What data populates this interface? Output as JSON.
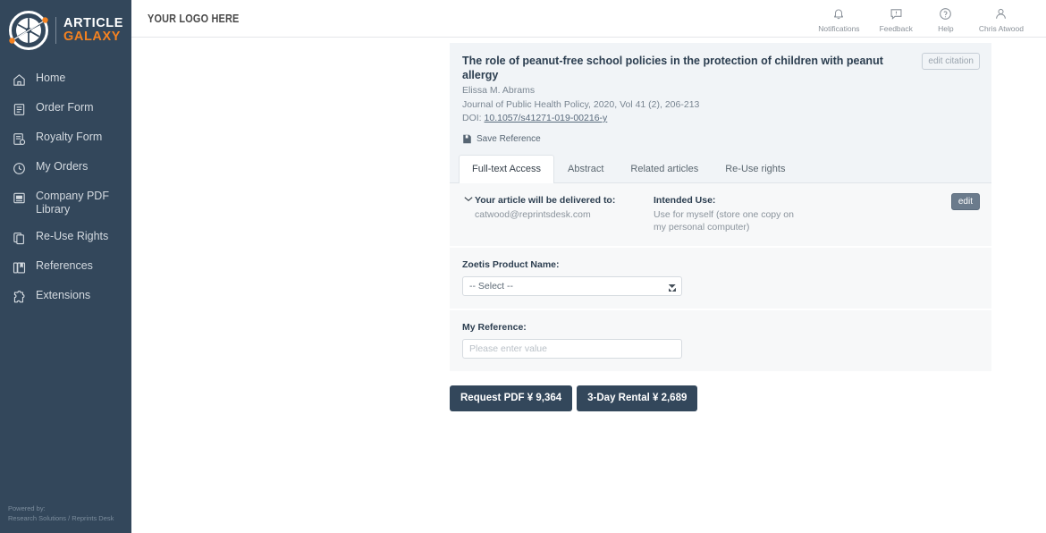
{
  "sidebar": {
    "logo": {
      "line1": "ARTICLE",
      "line2": "GALAXY",
      "icon": "galaxy-aperture-logo"
    },
    "items": [
      {
        "label": "Home",
        "icon": "home-icon"
      },
      {
        "label": "Order Form",
        "icon": "order-form-icon"
      },
      {
        "label": "Royalty Form",
        "icon": "royalty-form-icon"
      },
      {
        "label": "My Orders",
        "icon": "clock-history-icon"
      },
      {
        "label": "Company PDF Library",
        "icon": "pdf-library-icon"
      },
      {
        "label": "Re-Use Rights",
        "icon": "copy-documents-icon"
      },
      {
        "label": "References",
        "icon": "book-bookmark-icon"
      },
      {
        "label": "Extensions",
        "icon": "puzzle-piece-icon"
      }
    ],
    "powered_by_label": "Powered by:",
    "powered_by_value": "Research Solutions / Reprints Desk"
  },
  "topbar": {
    "brand_slot": "YOUR LOGO HERE",
    "nav": [
      {
        "label": "Notifications",
        "icon": "bell-icon"
      },
      {
        "label": "Feedback",
        "icon": "feedback-speech-bubble-icon"
      },
      {
        "label": "Help",
        "icon": "question-circle-icon"
      },
      {
        "label": "Chris Atwood",
        "icon": "user-account-icon"
      }
    ]
  },
  "citation": {
    "title": "The role of peanut-free school policies in the protection of children with peanut allergy",
    "authors": "Elissa M. Abrams",
    "source": "Journal of Public Health Policy, 2020, Vol 41 (2), 206-213",
    "doi_label": "DOI:",
    "doi_value": "10.1057/s41271-019-00216-y",
    "edit_citation_label": "edit citation",
    "save_reference_label": "Save Reference",
    "save_reference_icon": "save-bookmark-icon"
  },
  "tabs": [
    {
      "label": "Full-text Access",
      "active": true
    },
    {
      "label": "Abstract",
      "active": false
    },
    {
      "label": "Related articles",
      "active": false
    },
    {
      "label": "Re-Use rights",
      "active": false
    }
  ],
  "delivery": {
    "collapse_icon": "chevron-down-icon",
    "delivered_to_label": "Your article will be delivered to:",
    "delivered_to_value": "catwood@reprintsdesk.com",
    "intended_use_label": "Intended Use:",
    "intended_use_value": "Use for myself (store one copy on my personal computer)",
    "edit_label": "edit"
  },
  "product_field": {
    "label": "Zoetis Product Name:",
    "selected": "-- Select --"
  },
  "reference_field": {
    "label": "My Reference:",
    "value": "",
    "placeholder": "Please enter value"
  },
  "actions": [
    {
      "label": "Request PDF ¥ 9,364"
    },
    {
      "label": "3-Day Rental ¥ 2,689"
    }
  ],
  "colors": {
    "sidebar_bg": "#33475b",
    "accent_orange": "#f58220",
    "panel_bg": "#f7f8f9",
    "citation_bg": "#f1f4f7",
    "button_bg": "#33475b"
  }
}
